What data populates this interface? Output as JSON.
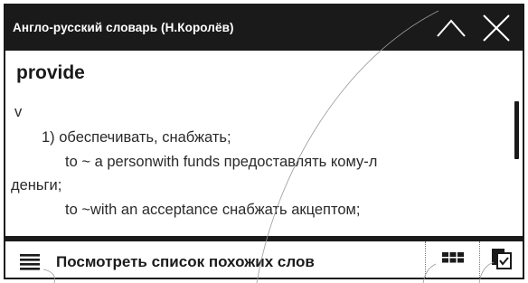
{
  "window": {
    "title": "Англо-русский словарь (Н.Королёв)"
  },
  "toolbar": {
    "up_icon": "chevron-up-icon",
    "close_icon": "close-icon"
  },
  "entry": {
    "headword": "provide",
    "part_of_speech": "v",
    "sense_1": "1) обеспечивать, снабжать;",
    "example_1_line_1": "to ~ a personwith funds предоставлять кому-л",
    "example_1_line_2": "деньги;",
    "example_2": "to ~with an acceptance снабжать акцептом;"
  },
  "bottombar": {
    "similar_words_label": "Посмотреть список похожих слов",
    "list_icon": "list-icon",
    "grid_icon": "grid-icon",
    "dictionary_icon": "dictionary-icon"
  },
  "colors": {
    "bar": "#1a1a1a",
    "text": "#2a2a2a",
    "background": "#ffffff"
  }
}
